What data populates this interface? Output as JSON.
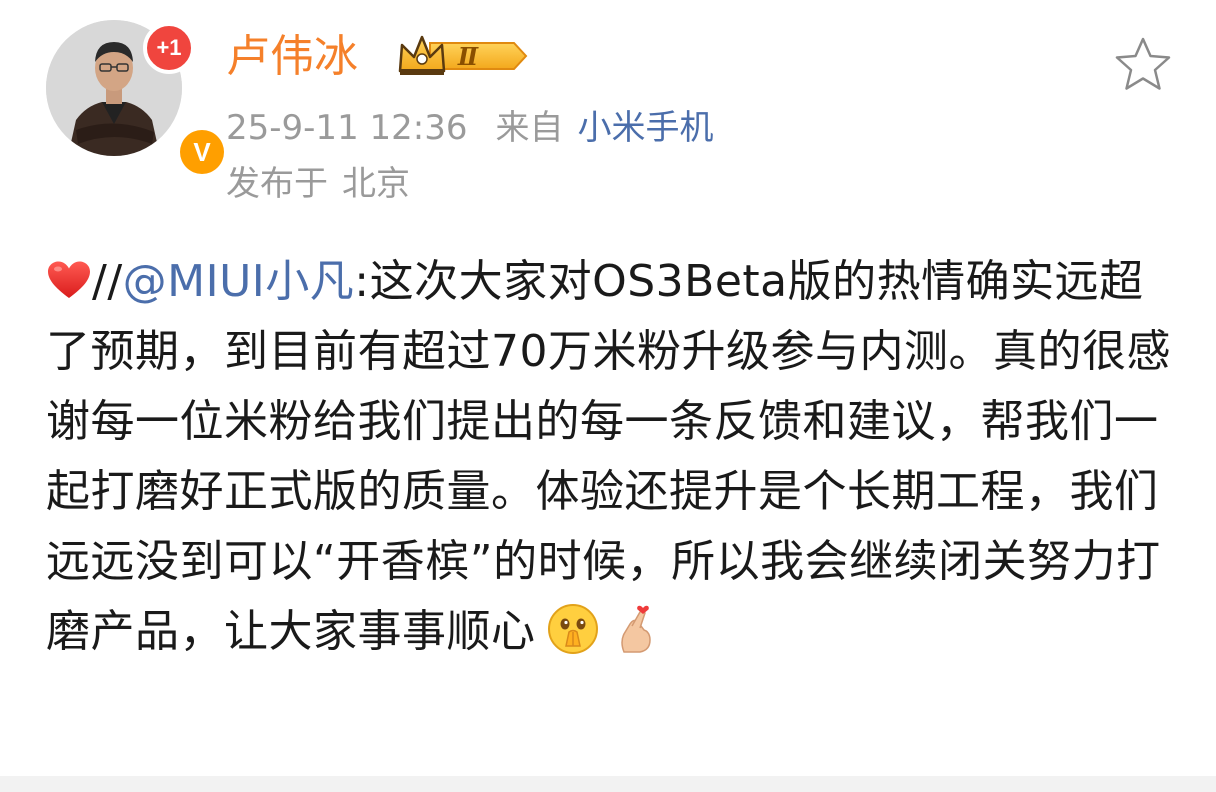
{
  "user": {
    "name": "卢伟冰",
    "new_count_badge": "+1",
    "verified_badge": "V",
    "vip_level": "Ⅱ"
  },
  "meta": {
    "timestamp": "25-9-11 12:36",
    "from_label": "来自",
    "source": "小米手机",
    "location_label": "发布于",
    "location": "北京"
  },
  "post": {
    "repost_prefix": "//",
    "mention": "@MIUI小凡",
    "body": ":这次大家对OS3Beta版的热情确实远超了预期，到目前有超过70万米粉升级参与内测。真的很感谢每一位米粉给我们提出的每一条反馈和建议，帮我们一起打磨好正式版的质量。体验还提升是个长期工程，我们远远没到可以“开香槟”的时候，所以我会继续闭关努力打磨产品，让大家事事顺心"
  },
  "icons": {
    "heart": "heart-icon",
    "pray": "pray-emoji-icon",
    "finger_heart": "finger-heart-emoji-icon",
    "favorite": "star-outline-icon"
  },
  "colors": {
    "username": "#f5802a",
    "link": "#4b6eab",
    "meta": "#9a9a9a",
    "badge_red": "#f0453e",
    "badge_orange": "#ff9f00"
  }
}
